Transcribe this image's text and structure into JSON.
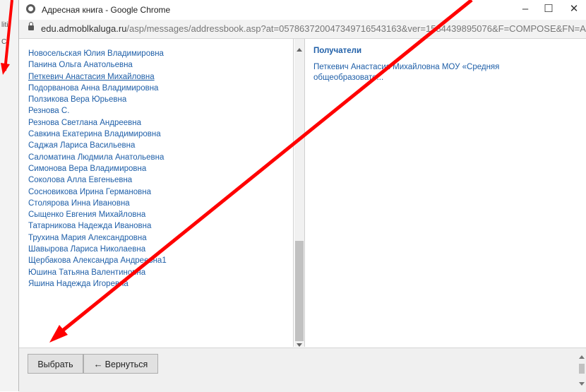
{
  "background_fragments": [
    "liti",
    "C"
  ],
  "window": {
    "title": "Адресная книга - Google Chrome",
    "controls": [
      "–",
      "☐",
      "✕"
    ]
  },
  "address_bar": {
    "host": "edu.admoblkaluga.ru",
    "path": "/asp/messages/addressbook.asp?at=05786372004734971654316​3&ver=1584439895076&F=COMPOSE&FN=A..."
  },
  "contacts": [
    "Новосельская Юлия Владимировна",
    "Панина Ольга Анатольевна",
    "Петкевич Анастасия Михайловна",
    "Подорванова Анна Владимировна",
    "Ползикова Вера Юрьевна",
    "Резнова С.",
    "Резнова Светлана Андреевна",
    "Савкина Екатерина Владимировна",
    "Саджая Лариса Васильевна",
    "Саломатина Людмила Анатольевна",
    "Симонова Вера Владимировна",
    "Соколова Алла Евгеньевна",
    "Сосновикова Ирина Германовна",
    "Столярова Инна Ивановна",
    "Сыщенко Евгения Михайловна",
    "Татарникова Надежда Ивановна",
    "Трухина Мария Александровна",
    "Шавырова Лариса Николаевна",
    "Щербакова Александра Андреевна1",
    "Юшина Татьяна Валентиновна",
    "Яшина Надежда Игоревна"
  ],
  "selected_contact_index": 2,
  "recipients": {
    "header": "Получатели",
    "items": [
      "Петкевич Анастасия Михайловна МОУ «Средняя общеобразовате..."
    ]
  },
  "buttons": {
    "choose": "Выбрать",
    "back_arrow": "←",
    "back": "Вернуться"
  },
  "colors": {
    "link": "#1f5fa8",
    "annotation_arrow": "#ff0000"
  }
}
